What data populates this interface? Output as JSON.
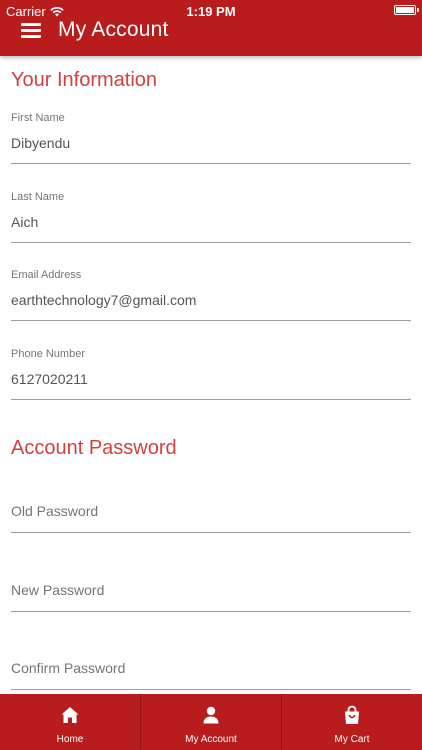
{
  "status_bar": {
    "carrier": "Carrier",
    "time": "1:19 PM"
  },
  "header": {
    "title": "My Account",
    "menu_icon": "hamburger-menu-icon"
  },
  "your_information": {
    "section_title": "Your Information",
    "fields": [
      {
        "label": "First Name",
        "value": "Dibyendu"
      },
      {
        "label": "Last Name",
        "value": "Aich"
      },
      {
        "label": "Email Address",
        "value": "earthtechnology7@gmail.com"
      },
      {
        "label": "Phone Number",
        "value": "6127020211"
      }
    ]
  },
  "account_password": {
    "section_title": "Account Password",
    "fields": [
      {
        "placeholder": "Old Password",
        "value": ""
      },
      {
        "placeholder": "New Password",
        "value": ""
      },
      {
        "placeholder": "Confirm Password",
        "value": ""
      }
    ]
  },
  "tab_bar": {
    "tabs": [
      {
        "label": "Home",
        "icon": "home-icon"
      },
      {
        "label": "My Account",
        "icon": "user-icon"
      },
      {
        "label": "My Cart",
        "icon": "shopping-bag-icon"
      }
    ]
  },
  "colors": {
    "brand": "#b91c1c",
    "section_title": "#d24040"
  }
}
